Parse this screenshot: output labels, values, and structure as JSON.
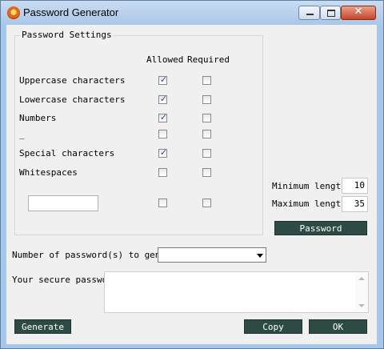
{
  "window": {
    "title": "Password Generator",
    "icon": "app-shield-icon",
    "controls": {
      "minimize": "minimize-icon",
      "maximize": "maximize-icon",
      "close_glyph": "✕"
    }
  },
  "settings": {
    "group_title": "Password Settings",
    "headers": {
      "allowed": "Allowed",
      "required": "Required"
    },
    "rows": [
      {
        "label": "Uppercase characters",
        "allowed": true,
        "required": false
      },
      {
        "label": "Lowercase characters",
        "allowed": true,
        "required": false
      },
      {
        "label": "Numbers",
        "allowed": true,
        "required": false
      },
      {
        "label": "_",
        "allowed": false,
        "required": false
      },
      {
        "label": "Special characters",
        "allowed": true,
        "required": false
      },
      {
        "label": "Whitespaces",
        "allowed": false,
        "required": false
      },
      {
        "label": "",
        "allowed": false,
        "required": false
      }
    ],
    "custom_chars_value": ""
  },
  "length": {
    "min_label": "Minimum length:",
    "min_value": "10",
    "max_label": "Maximum length:",
    "max_value": "35",
    "password_button": "Password"
  },
  "generate_count": {
    "label": "Number of password(s) to generate:",
    "selected": ""
  },
  "output": {
    "label": "Your secure passwor",
    "value": ""
  },
  "buttons": {
    "generate": "Generate",
    "copy": "Copy",
    "ok": "OK"
  },
  "colors": {
    "button_bg": "#2d4a44",
    "frame": "#a9c7e8",
    "client_bg": "#f0f0f0",
    "check": "#2b4f8c"
  }
}
